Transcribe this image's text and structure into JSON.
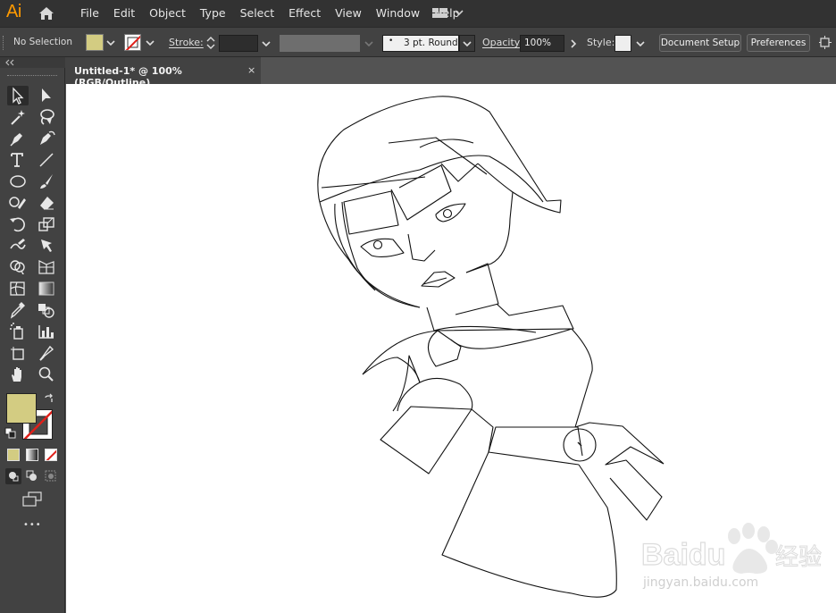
{
  "app": {
    "logo": "Ai"
  },
  "menu": [
    "File",
    "Edit",
    "Object",
    "Type",
    "Select",
    "Effect",
    "View",
    "Window",
    "Help"
  ],
  "control_bar": {
    "selection_status": "No Selection",
    "stroke_label": "Stroke:",
    "brush_value": "3 pt. Round",
    "opacity_label": "Opacity:",
    "opacity_value": "100%",
    "style_label": "Style:",
    "document_setup_label": "Document Setup",
    "preferences_label": "Preferences",
    "fill_color": "#d3cc82"
  },
  "document_tab": {
    "title": "Untitled-1* @ 100% (RGB/Outline)",
    "close": "×"
  },
  "tools": [
    "selection-tool",
    "direct-selection-tool",
    "magic-wand-tool",
    "lasso-tool",
    "pen-tool",
    "curvature-tool",
    "type-tool",
    "line-segment-tool",
    "ellipse-tool",
    "paintbrush-tool",
    "shaper-tool",
    "eraser-tool",
    "rotate-tool",
    "scale-tool",
    "warp-tool",
    "free-transform-tool",
    "shape-builder-tool",
    "perspective-grid-tool",
    "mesh-tool",
    "gradient-tool",
    "eyedropper-tool",
    "blend-tool",
    "symbol-sprayer-tool",
    "column-graph-tool",
    "artboard-tool",
    "slice-tool",
    "hand-tool",
    "zoom-tool"
  ],
  "toolbox": {
    "fill_color": "#d3cc82",
    "more": "•••"
  },
  "watermark": {
    "brand": "Baidu",
    "brand_cn": "经验",
    "url": "jingyan.baidu.com"
  }
}
